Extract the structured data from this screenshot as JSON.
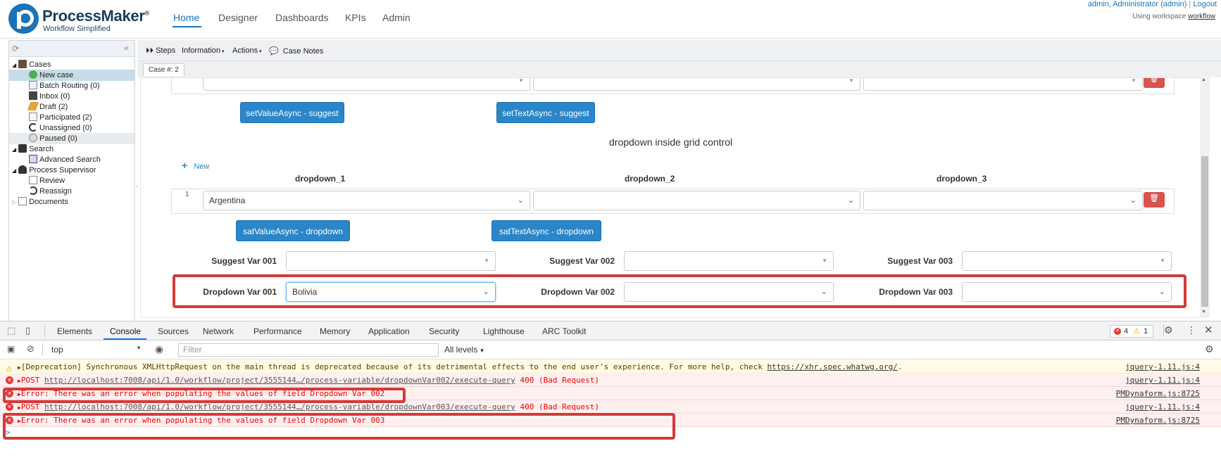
{
  "header": {
    "brand": "ProcessMaker",
    "brand_reg": "®",
    "tagline": "Workflow Simplified",
    "nav": [
      "Home",
      "Designer",
      "Dashboards",
      "KPIs",
      "Admin"
    ],
    "user": "admin, Administrator (admin)",
    "separator": "|",
    "logout": "Logout",
    "workspace_prefix": "Using workspace",
    "workspace": "workflow"
  },
  "tree": {
    "cases": "Cases",
    "new_case": "New case",
    "batch_routing": "Batch Routing (0)",
    "inbox": "Inbox (0)",
    "draft": "Draft (2)",
    "participated": "Participated (2)",
    "unassigned": "Unassigned (0)",
    "paused": "Paused (0)",
    "search": "Search",
    "advanced_search": "Advanced Search",
    "process_supervisor": "Process Supervisor",
    "review": "Review",
    "reassign": "Reassign",
    "documents": "Documents"
  },
  "toolbar": {
    "steps": "Steps",
    "information": "Information",
    "actions": "Actions",
    "case_notes": "Case Notes",
    "case_tab": "Case #: 2"
  },
  "form": {
    "btn_set_value_suggest": "setValueAsync - suggest",
    "btn_set_text_suggest": "setTextAsync - suggest",
    "grid_title": "dropdown inside grid control",
    "new_label": "New",
    "col1": "dropdown_1",
    "col2": "dropdown_2",
    "col3": "dropdown_3",
    "row_index": "1",
    "row_value": "Argentina",
    "btn_sat_value_dropdown": "satValueAsync - dropdown",
    "btn_sat_text_dropdown": "satTextAsync - dropdown",
    "suggest_var_001": "Suggest Var 001",
    "suggest_var_002": "Suggest Var 002",
    "suggest_var_003": "Suggest Var 003",
    "dropdown_var_001": "Dropdown Var 001",
    "dropdown_var_002": "Dropdown Var 002",
    "dropdown_var_003": "Dropdown Var 003",
    "dropdown_var_001_value": "Bolivia"
  },
  "devtools": {
    "tabs": [
      "Elements",
      "Console",
      "Sources",
      "Network",
      "Performance",
      "Memory",
      "Application",
      "Security",
      "Lighthouse",
      "ARC Toolkit"
    ],
    "context": "top",
    "filter_placeholder": "Filter",
    "levels": "All levels",
    "err_count": "4",
    "warn_count": "1",
    "logs": [
      {
        "type": "warn",
        "pre": "[Deprecation] Synchronous XMLHttpRequest on the main thread is deprecated because of its detrimental effects to the end user's experience. For more help, check ",
        "link": "https://xhr.spec.whatwg.org/",
        "post": ".",
        "src": "jquery-1.11.js:4"
      },
      {
        "type": "err",
        "pre": "POST ",
        "link": "http://localhost:7008/api/1.0/workflow/project/3555144…/process-variable/dropdownVar002/execute-query",
        "post": " 400 (Bad Request)",
        "src": "jquery-1.11.js:4"
      },
      {
        "type": "err",
        "pre": "Error: There was an error when populating the values of field Dropdown Var 002",
        "link": "",
        "post": "",
        "src": "PMDynaform.js:8725"
      },
      {
        "type": "err",
        "pre": "POST ",
        "link": "http://localhost:7008/api/1.0/workflow/project/3555144…/process-variable/dropdownVar003/execute-query",
        "post": " 400 (Bad Request)",
        "src": "jquery-1.11.js:4"
      },
      {
        "type": "err",
        "pre": "Error: There was an error when populating the values of field Dropdown Var 003",
        "link": "",
        "post": "",
        "src": "PMDynaform.js:8725"
      }
    ],
    "prompt": ">"
  },
  "colors": {
    "brand": "#1a73b8",
    "button_blue": "#2a86c9",
    "delete_red": "#d9534f",
    "highlight": "#d43a3a"
  }
}
